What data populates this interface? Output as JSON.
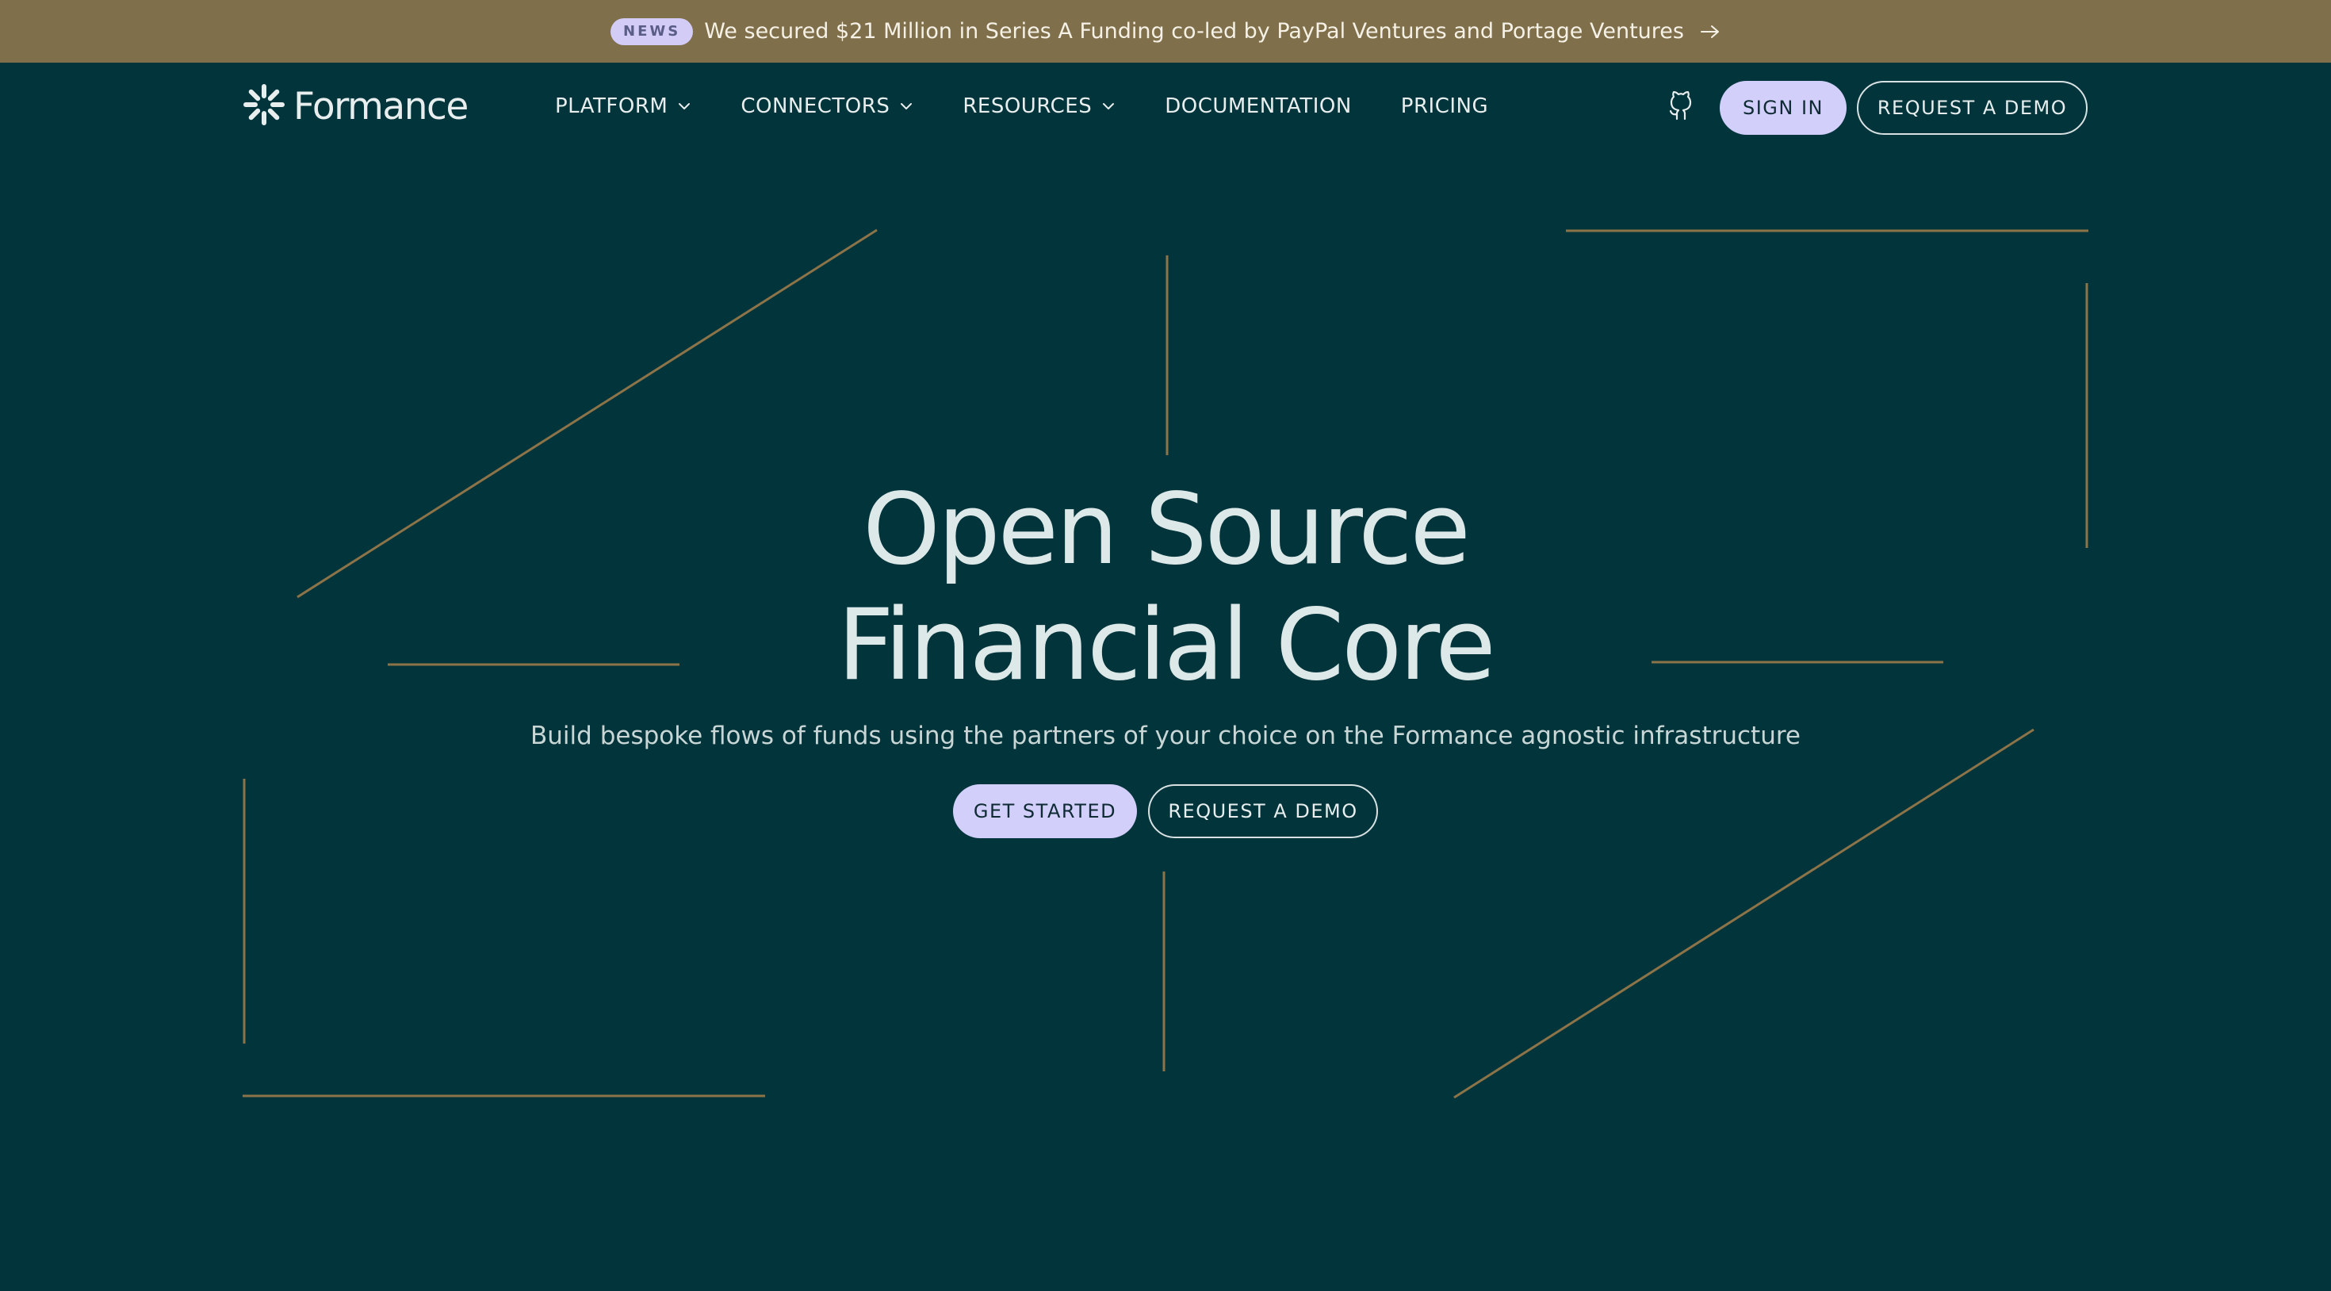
{
  "banner": {
    "badge": "NEWS",
    "text": "We secured $21 Million in Series A Funding co-led by PayPal Ventures and Portage Ventures",
    "arrow_icon": "arrow-right-icon"
  },
  "nav": {
    "logo_text": "Formance",
    "menu": [
      {
        "label": "PLATFORM",
        "has_dropdown": true
      },
      {
        "label": "CONNECTORS",
        "has_dropdown": true
      },
      {
        "label": "RESOURCES",
        "has_dropdown": true
      },
      {
        "label": "DOCUMENTATION",
        "has_dropdown": false
      },
      {
        "label": "PRICING",
        "has_dropdown": false
      }
    ],
    "github_icon": "github-icon",
    "sign_in": "SIGN IN",
    "request_demo": "REQUEST A DEMO"
  },
  "hero": {
    "title_line1": "Open Source",
    "title_line2": "Financial Core",
    "subtitle": "Build bespoke flows of funds using the partners of your choice on the Formance agnostic infrastructure",
    "get_started": "GET STARTED",
    "request_demo": "REQUEST A DEMO"
  },
  "colors": {
    "background": "#01343B",
    "banner": "#7F6F4A",
    "accent": "#D3CFFB",
    "line": "#8C7348"
  }
}
